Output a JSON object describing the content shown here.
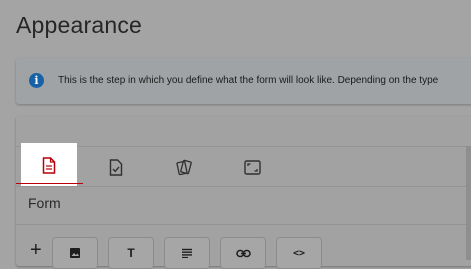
{
  "page": {
    "title": "Appearance"
  },
  "info": {
    "icon": "info-icon",
    "text": "This is the step in which you define what the form will look like. Depending on the type"
  },
  "tabs": [
    {
      "icon": "form-document-icon",
      "active": true
    },
    {
      "icon": "checklist-icon",
      "active": false
    },
    {
      "icon": "cards-icon",
      "active": false
    },
    {
      "icon": "fullscreen-icon",
      "active": false
    }
  ],
  "section": {
    "label": "Form"
  },
  "toolbar": {
    "add_label": "+",
    "buttons": [
      {
        "icon": "image-icon"
      },
      {
        "icon": "text-icon",
        "glyph": "T"
      },
      {
        "icon": "paragraph-icon"
      },
      {
        "icon": "link-icon"
      },
      {
        "icon": "code-icon",
        "glyph": "<>"
      }
    ]
  },
  "colors": {
    "accent": "#b8000b",
    "info": "#1762a6"
  }
}
